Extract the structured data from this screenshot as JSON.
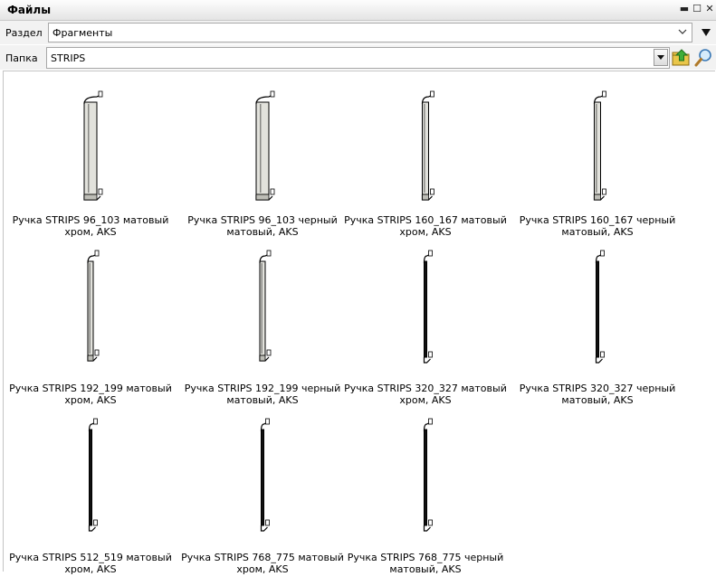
{
  "window": {
    "title": "Файлы",
    "minimize_symbol": "▬",
    "maximize_symbol": "☐",
    "close_symbol": "✕"
  },
  "section_row": {
    "label": "Раздел",
    "value": "Фрагменты",
    "extra_dropdown_icon": "triangle-down"
  },
  "folder_row": {
    "label": "Папка",
    "value": "STRIPS",
    "buttons": [
      "folder-up-icon",
      "search-icon"
    ]
  },
  "items": [
    {
      "caption": "Ручка STRIPS 96_103 матовый хром, AKS",
      "finish": "chrome",
      "size": "96"
    },
    {
      "caption": "Ручка STRIPS 96_103 черный матовый, AKS",
      "finish": "chrome",
      "size": "96"
    },
    {
      "caption": "Ручка STRIPS 160_167 матовый хром, AKS",
      "finish": "chrome",
      "size": "160"
    },
    {
      "caption": "Ручка STRIPS 160_167 черный матовый, AKS",
      "finish": "chrome",
      "size": "160"
    },
    {
      "caption": "Ручка STRIPS 192_199 матовый хром, AKS",
      "finish": "chrome",
      "size": "192"
    },
    {
      "caption": "Ручка STRIPS 192_199 черный матовый, AKS",
      "finish": "chrome",
      "size": "192"
    },
    {
      "caption": "Ручка STRIPS 320_327 матовый хром, AKS",
      "finish": "black",
      "size": "320"
    },
    {
      "caption": "Ручка STRIPS 320_327 черный матовый, AKS",
      "finish": "black",
      "size": "320"
    },
    {
      "caption": "Ручка STRIPS 512_519 матовый хром, AKS",
      "finish": "black",
      "size": "512"
    },
    {
      "caption": "Ручка STRIPS 768_775 матовый хром, AKS",
      "finish": "black",
      "size": "768"
    },
    {
      "caption": "Ручка STRIPS 768_775 черный матовый, AKS",
      "finish": "black",
      "size": "768"
    }
  ],
  "colors": {
    "titlebar": "#e8e8e8",
    "toolbar": "#f2f2f2",
    "handle_light": "#e2e2dc",
    "handle_dark": "#111111"
  }
}
